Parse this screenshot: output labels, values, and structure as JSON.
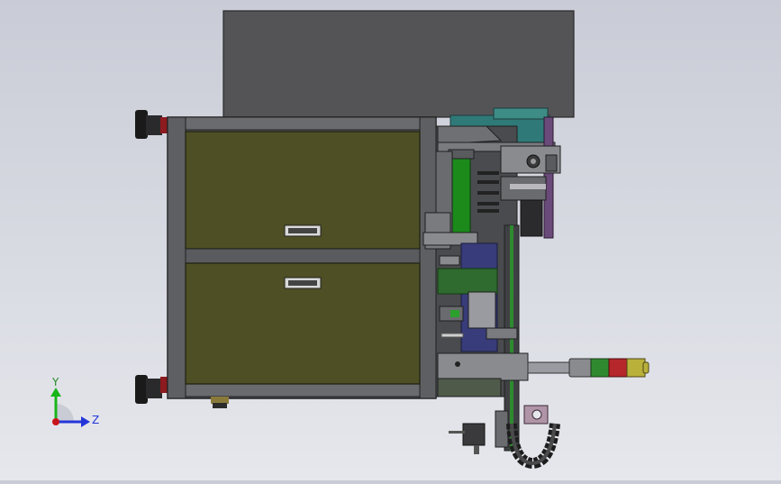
{
  "viewport": {
    "background_top": "#c9ccd6",
    "background_bottom": "#e6e7ec"
  },
  "triad": {
    "y_label": "Y",
    "z_label": "Z",
    "y_color": "#17b51a",
    "z_color": "#2436d8",
    "origin_color": "#c8151b"
  },
  "colors": {
    "cabinet_frame": "#58595c",
    "drawer": "#4e4f24",
    "top_box": "#545457",
    "teal_panel": "#2f7a78",
    "roller_green": "#1b8a1b",
    "purple_panel": "#6a4a7a",
    "navy_block": "#383c7a",
    "signal_red": "#b5272a",
    "signal_green": "#2f8a2f",
    "signal_yellow": "#b9b13a"
  },
  "icons": {
    "drawer_handle": "handle-icon",
    "leveling_foot": "foot-icon",
    "signal_tower": "signal-tower-icon",
    "cable_chain": "cable-chain-icon"
  }
}
